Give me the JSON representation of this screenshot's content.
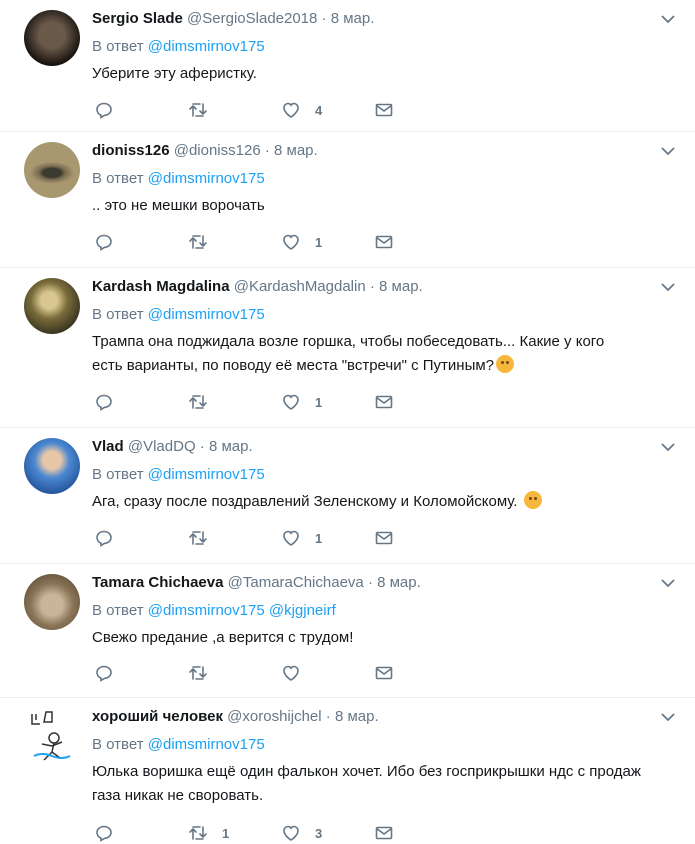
{
  "reply_prefix": "В ответ",
  "tweets": [
    {
      "fullname": "Sergio Slade",
      "handle": "@SergioSlade2018",
      "time": "8 мар.",
      "reply_to": [
        "@dimsmirnov175"
      ],
      "text": "Уберите эту аферистку.",
      "retweets": "",
      "likes": "4",
      "avatar_color": "#2b2420"
    },
    {
      "fullname": "dioniss126",
      "handle": "@dioniss126",
      "time": "8 мар.",
      "reply_to": [
        "@dimsmirnov175"
      ],
      "text": ".. это не мешки ворочать",
      "retweets": "",
      "likes": "1",
      "avatar_color": "#8a7a5a"
    },
    {
      "fullname": "Kardash Magdalina",
      "handle": "@KardashMagdalin",
      "time": "8 мар.",
      "reply_to": [
        "@dimsmirnov175"
      ],
      "text": "Трампа она поджидала возле горшка, чтобы побеседовать... Какие у кого есть варианты, по поводу её места \"встречи\" с Путиным?",
      "emoji": "thinking-face",
      "retweets": "",
      "likes": "1",
      "avatar_color": "#6f6a3a"
    },
    {
      "fullname": "Vlad",
      "handle": "@VladDQ",
      "time": "8 мар.",
      "reply_to": [
        "@dimsmirnov175"
      ],
      "text": "Ага, сразу после поздравлений Зеленскому и Коломойскому.",
      "emoji": "rolling-laughing-face",
      "retweets": "",
      "likes": "1",
      "avatar_color": "#3a78c8"
    },
    {
      "fullname": "Tamara Chichaeva",
      "handle": "@TamaraChichaeva",
      "time": "8 мар.",
      "reply_to": [
        "@dimsmirnov175",
        "@kjgjneirf"
      ],
      "text": "Свежо предание ,а верится с трудом!",
      "retweets": "",
      "likes": "",
      "avatar_color": "#9a8a70"
    },
    {
      "fullname": "хороший человек",
      "handle": "@xoroshijchel",
      "time": "8 мар.",
      "reply_to": [
        "@dimsmirnov175"
      ],
      "text": "Юлька воришка ещё один фалькон хочет. Ибо без госприкрышки ндс с продаж газа никак не своровать.",
      "retweets": "1",
      "likes": "3",
      "avatar_color": "#ffffff"
    }
  ],
  "colors": {
    "accent": "#1da1f2",
    "secondary_text": "#657786",
    "divider": "#e6ecf0"
  }
}
